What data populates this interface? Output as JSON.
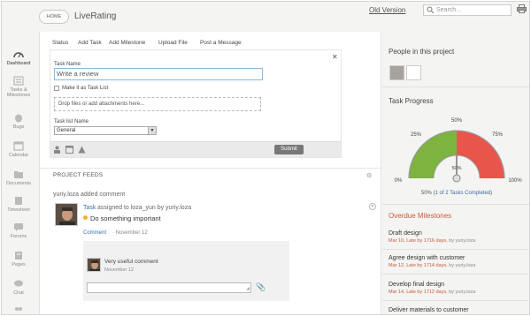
{
  "header": {
    "home_label": "HOME",
    "app_title": "LiveRating",
    "old_version": "Old Version",
    "search_placeholder": "Search...",
    "icons": [
      "search-icon",
      "print-icon",
      "chevron-down-icon"
    ]
  },
  "nav": {
    "items": [
      {
        "label": "Dashboard",
        "icon": "dashboard-icon"
      },
      {
        "label": "Tasks &",
        "label2": "Milestones",
        "icon": "tasks-icon"
      },
      {
        "label": "Bugs",
        "icon": "bug-icon"
      },
      {
        "label": "Calendar",
        "icon": "calendar-icon"
      },
      {
        "label": "Documents",
        "icon": "documents-icon"
      },
      {
        "label": "Timesheet",
        "icon": "timesheet-icon"
      },
      {
        "label": "Forums",
        "icon": "forums-icon"
      },
      {
        "label": "Pages",
        "icon": "pages-icon"
      },
      {
        "label": "Chat",
        "icon": "chat-icon"
      }
    ]
  },
  "tabs": [
    "Status",
    "Add Task",
    "Add Milestone",
    "Upload File",
    "Post a Message"
  ],
  "task_form": {
    "task_name_label": "Task Name",
    "task_name_value": "Write a review",
    "task_list_checkbox_label": "Make it as Task List",
    "drop_zone_text": "Drop files or add attachments here...",
    "task_list_name_label": "Task list Name",
    "task_list_value": "General",
    "submit_label": "Submit"
  },
  "feeds": {
    "title": "PROJECT FEEDS",
    "author_line": "yuriy.loza added comment",
    "task_link": "Task",
    "task_desc": "assigned to loza_yun by yuriy.loza",
    "task_name": "Do something important",
    "comment_link": "Comment",
    "comment_date": "· November 12",
    "comment_text": "Very useful comment",
    "comment_date2": "November 12"
  },
  "right": {
    "people_title": "People in this project",
    "progress_title": "Task Progress",
    "gauge_labels": {
      "l0": "0%",
      "l25": "25%",
      "l50": "50%",
      "l75": "75%",
      "l100": "100%",
      "center": "50%"
    },
    "progress_caption_prefix": "50% (",
    "progress_caption_link": "1 of 2 Tasks Completed",
    "progress_caption_suffix": ")",
    "milestones_title": "Overdue Milestones",
    "milestones": [
      {
        "title": "Draft design",
        "date": "Mar 10,",
        "late": "Late by 1716 days,",
        "by": "by yuriy.loza"
      },
      {
        "title": "Agree design with customer",
        "date": "Mar 12,",
        "late": "Late by 1714 days,",
        "by": "by yuriy.loza"
      },
      {
        "title": "Develop final design",
        "date": "Mar 14,",
        "late": "Late by 1712 days,",
        "by": "by yuriy.loza"
      },
      {
        "title": "Deliver materials to customer",
        "date": "",
        "late": "",
        "by": ""
      }
    ],
    "colors": {
      "accent_red": "#c9583a",
      "link_blue": "#3b6d9e",
      "gauge_green": "#7db33f",
      "gauge_red": "#e8554b"
    }
  },
  "chart_data": {
    "type": "gauge",
    "value": 50,
    "min": 0,
    "max": 100,
    "ticks": [
      "0%",
      "25%",
      "50%",
      "75%",
      "100%"
    ]
  }
}
